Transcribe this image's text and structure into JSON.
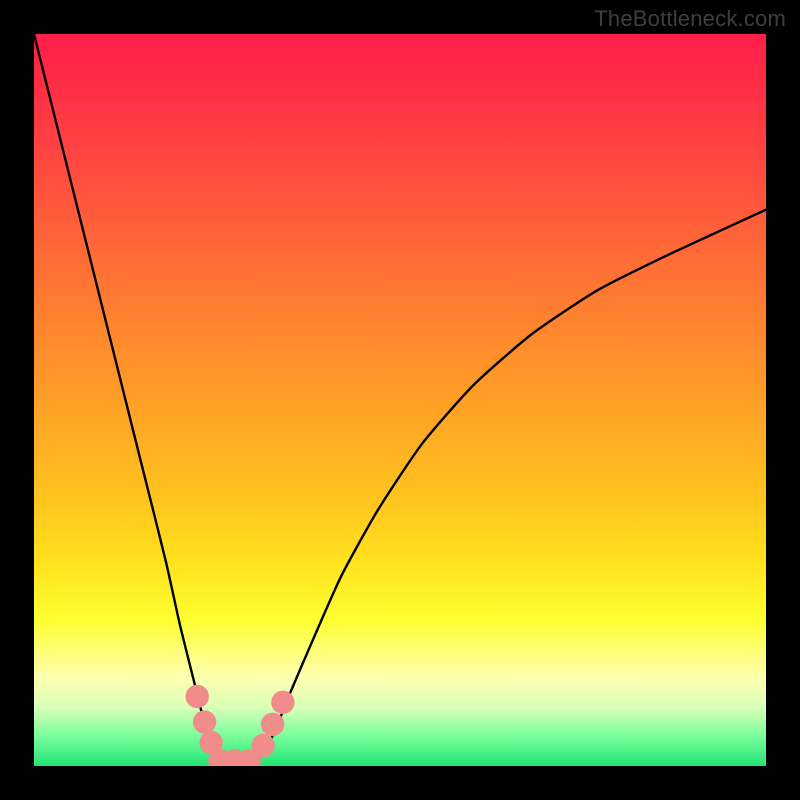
{
  "watermark": "TheBottleneck.com",
  "chart_data": {
    "type": "line",
    "title": "",
    "xlabel": "",
    "ylabel": "",
    "xlim": [
      0,
      100
    ],
    "ylim": [
      0,
      100
    ],
    "grid": false,
    "background_gradient": {
      "direction": "vertical",
      "stops": [
        {
          "pos": 0.0,
          "color": "#ff1f4a"
        },
        {
          "pos": 0.5,
          "color": "#ff9a28"
        },
        {
          "pos": 0.8,
          "color": "#feff2f"
        },
        {
          "pos": 1.0,
          "color": "#1fe474"
        }
      ]
    },
    "series": [
      {
        "name": "bottleneck-curve",
        "color": "#000000",
        "x": [
          0,
          3,
          6,
          9,
          12,
          15,
          18,
          20,
          22,
          23,
          24,
          25,
          26,
          27,
          28,
          29,
          30,
          31,
          32,
          33,
          35,
          38,
          42,
          47,
          53,
          60,
          68,
          77,
          87,
          100
        ],
        "values": [
          100,
          88,
          76,
          64,
          52,
          40,
          28,
          19,
          11,
          7,
          4,
          1.5,
          0,
          0,
          0,
          0,
          0.5,
          1.5,
          3,
          5,
          10,
          17,
          26,
          35,
          44,
          52,
          59,
          65,
          70,
          76
        ]
      }
    ],
    "markers": [
      {
        "name": "marker-falling-1",
        "x": 22.3,
        "y": 9.5,
        "color": "#f08d8b",
        "r": 1.6
      },
      {
        "name": "marker-falling-2",
        "x": 23.3,
        "y": 6.0,
        "color": "#f08d8b",
        "r": 1.6
      },
      {
        "name": "marker-falling-3",
        "x": 24.2,
        "y": 3.2,
        "color": "#f08d8b",
        "r": 1.6
      },
      {
        "name": "marker-trough-1",
        "x": 25.4,
        "y": 0.7,
        "color": "#f08d8b",
        "r": 1.6
      },
      {
        "name": "marker-trough-2",
        "x": 27.4,
        "y": 0.7,
        "color": "#f08d8b",
        "r": 1.6
      },
      {
        "name": "marker-trough-3",
        "x": 29.4,
        "y": 0.7,
        "color": "#f08d8b",
        "r": 1.6
      },
      {
        "name": "marker-rising-1",
        "x": 31.3,
        "y": 2.8,
        "color": "#f08d8b",
        "r": 1.6
      },
      {
        "name": "marker-rising-2",
        "x": 32.6,
        "y": 5.7,
        "color": "#f08d8b",
        "r": 1.6
      },
      {
        "name": "marker-rising-3",
        "x": 34.0,
        "y": 8.7,
        "color": "#f08d8b",
        "r": 1.6
      }
    ]
  }
}
